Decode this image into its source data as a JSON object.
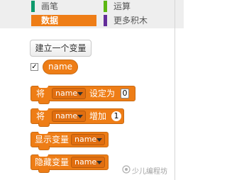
{
  "categories": [
    {
      "label": "画笔",
      "color": "#0e9a6c",
      "active": false
    },
    {
      "label": "运算",
      "color": "#5cb712",
      "active": false
    },
    {
      "label": "数据",
      "color": "#ee7d16",
      "active": true
    },
    {
      "label": "更多积木",
      "color": "#632d99",
      "active": false
    }
  ],
  "make_variable_button": "建立一个变量",
  "variable": {
    "checked": "✓",
    "name": "name"
  },
  "blocks": {
    "set": {
      "prefix": "将",
      "var": "name",
      "action": "设定为",
      "value": "0"
    },
    "change": {
      "prefix": "将",
      "var": "name",
      "action": "增加",
      "value": "1"
    },
    "show": {
      "label": "显示变量",
      "var": "name"
    },
    "hide": {
      "label": "隐藏变量",
      "var": "name"
    }
  },
  "watermark": "少儿编程坊",
  "colors": {
    "data": "#ee7d16",
    "pen": "#0e9a6c",
    "operators": "#5cb712",
    "more": "#632d99"
  }
}
